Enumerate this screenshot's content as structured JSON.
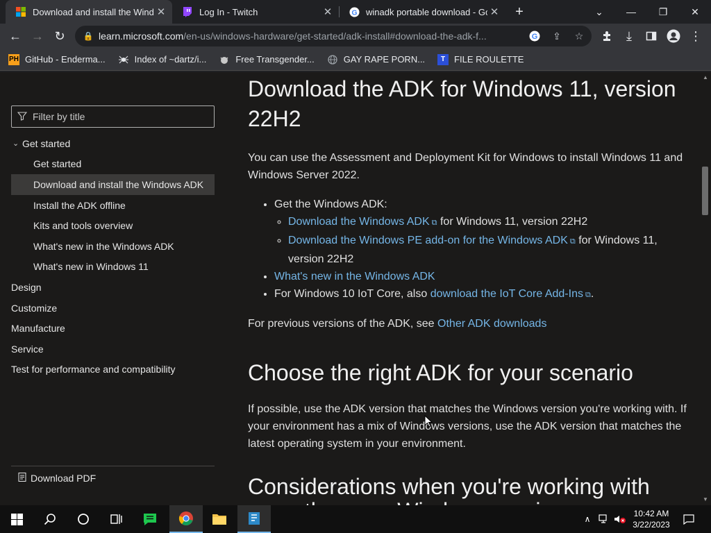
{
  "browser": {
    "tabs": [
      {
        "title": "Download and install the Windo",
        "active": true
      },
      {
        "title": "Log In - Twitch",
        "active": false
      },
      {
        "title": "winadk portable download - Goo",
        "active": false
      }
    ],
    "address": {
      "domain": "learn.microsoft.com",
      "path": "/en-us/windows-hardware/get-started/adk-install#download-the-adk-f..."
    },
    "bookmarks": [
      {
        "label": "GitHub - Enderma...",
        "icon": "PH"
      },
      {
        "label": "Index of ~dartz/i...",
        "icon": ""
      },
      {
        "label": "Free Transgender...",
        "icon": ""
      },
      {
        "label": "GAY RAPE PORN...",
        "icon": ""
      },
      {
        "label": "FILE ROULETTE",
        "icon": "T"
      }
    ]
  },
  "sidebar": {
    "filter_placeholder": "Filter by title",
    "toc": [
      {
        "label": "Get started",
        "level": 1,
        "expanded": true
      },
      {
        "label": "Get started",
        "level": 2
      },
      {
        "label": "Download and install the Windows ADK",
        "level": 2,
        "selected": true
      },
      {
        "label": "Install the ADK offline",
        "level": 2
      },
      {
        "label": "Kits and tools overview",
        "level": 2
      },
      {
        "label": "What's new in the Windows ADK",
        "level": 2
      },
      {
        "label": "What's new in Windows 11",
        "level": 2
      },
      {
        "label": "Design",
        "level": 1
      },
      {
        "label": "Customize",
        "level": 1
      },
      {
        "label": "Manufacture",
        "level": 1
      },
      {
        "label": "Service",
        "level": 1
      },
      {
        "label": "Test for performance and compatibility",
        "level": 1
      }
    ],
    "download_pdf": "Download PDF"
  },
  "content": {
    "h_download": "Download the ADK for Windows 11, version 22H2",
    "intro": "You can use the Assessment and Deployment Kit for Windows to install Windows 11 and Windows Server 2022.",
    "get_adk": "Get the Windows ADK:",
    "link_adk": "Download the Windows ADK",
    "adk_suffix": "for Windows 11, version 22H2",
    "link_pe": "Download the Windows PE add-on for the Windows ADK",
    "pe_suffix": "for Windows 11, version 22H2",
    "link_whatsnew": "What's new in the Windows ADK",
    "iot_prefix": "For Windows 10 IoT Core, also",
    "link_iot": "download the IoT Core Add-Ins",
    "iot_suffix": ".",
    "prev_prefix": "For previous versions of the ADK, see",
    "link_other": "Other ADK downloads",
    "h_choose": "Choose the right ADK for your scenario",
    "choose_body": "If possible, use the ADK version that matches the Windows version you're working with. If your environment has a mix of Windows versions, use the ADK version that matches the latest operating system in your environment.",
    "h_consider": "Considerations when you're working with more than one Windows version"
  },
  "taskbar": {
    "time": "10:42 AM",
    "date": "3/22/2023"
  },
  "colors": {
    "link": "#75b6e7",
    "background": "#1b1a19",
    "chrome_toolbar": "#35363a"
  }
}
